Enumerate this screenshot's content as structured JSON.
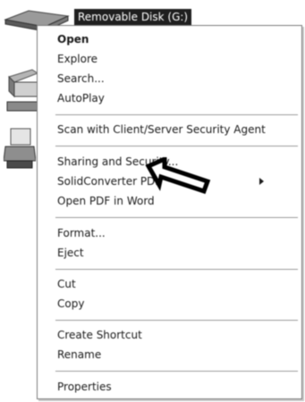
{
  "desktop": {
    "drive_label": "Removable Disk (G:)",
    "drive_icon": "removable-disk-icon",
    "side_icons": [
      "computer-icon",
      "printer-icon"
    ]
  },
  "context_menu": {
    "items": [
      {
        "label": "Open",
        "bold": true
      },
      {
        "label": "Explore"
      },
      {
        "label": "Search..."
      },
      {
        "label": "AutoPlay"
      },
      {
        "label": "Scan with Client/Server Security Agent"
      },
      {
        "label": "Sharing and Security..."
      },
      {
        "label": "SolidConverter PDF",
        "has_submenu": true
      },
      {
        "label": "Open PDF in Word"
      },
      {
        "label": "Format..."
      },
      {
        "label": "Eject"
      },
      {
        "label": "Cut"
      },
      {
        "label": "Copy"
      },
      {
        "label": "Create Shortcut"
      },
      {
        "label": "Rename"
      },
      {
        "label": "Properties"
      }
    ]
  },
  "annotation": {
    "icon": "pointing-arrow-icon",
    "color": "#000000"
  }
}
